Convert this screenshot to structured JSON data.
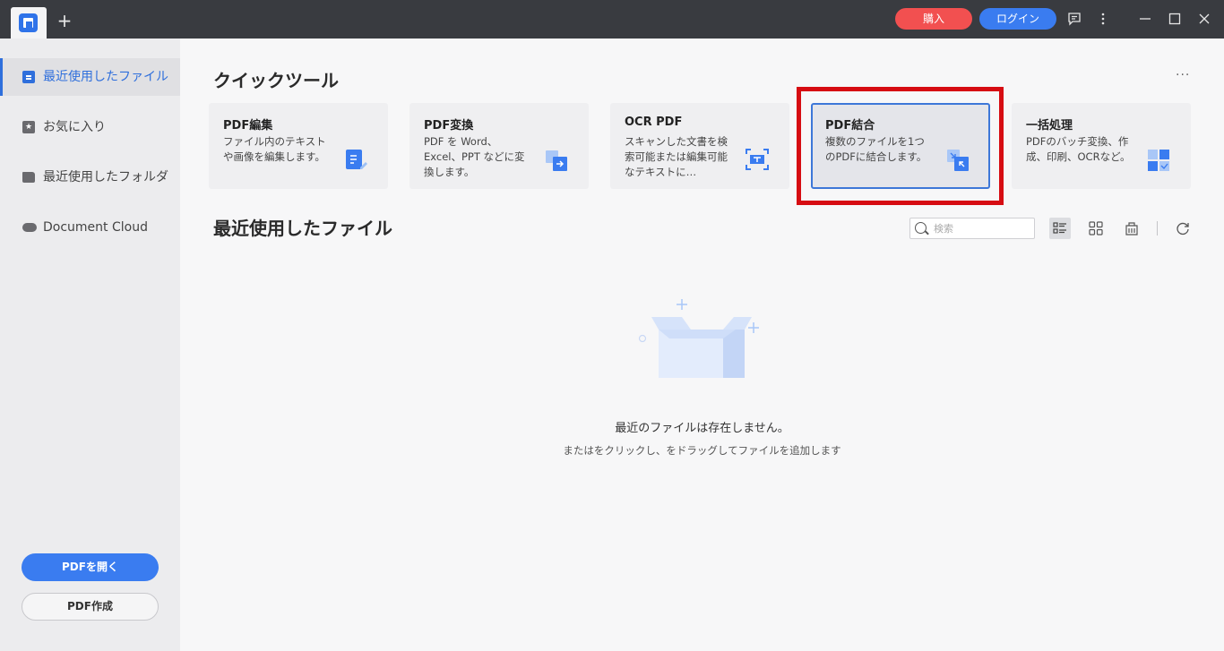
{
  "titlebar": {
    "buy_label": "購入",
    "login_label": "ログイン",
    "new_tab_symbol": "+"
  },
  "sidebar": {
    "items": [
      {
        "label": "最近使用したファイル",
        "icon": "recent-file-icon",
        "active": true
      },
      {
        "label": "お気に入り",
        "icon": "star-icon",
        "active": false
      },
      {
        "label": "最近使用したフォルダ",
        "icon": "folder-icon",
        "active": false
      },
      {
        "label": "Document Cloud",
        "icon": "cloud-icon",
        "active": false
      }
    ],
    "open_pdf_label": "PDFを開く",
    "create_pdf_label": "PDF作成"
  },
  "quick_tools": {
    "title": "クイックツール",
    "more_symbol": "···",
    "cards": [
      {
        "title": "PDF編集",
        "desc": "ファイル内のテキストや画像を編集します。",
        "icon": "edit-pdf-icon"
      },
      {
        "title": "PDF変換",
        "desc": "PDF を Word、Excel、PPT などに変換します。",
        "icon": "convert-pdf-icon"
      },
      {
        "title": "OCR PDF",
        "desc": "スキャンした文書を検索可能または編集可能なテキストに…",
        "icon": "ocr-icon"
      },
      {
        "title": "PDF結合",
        "desc": "複数のファイルを1つのPDFに結合します。",
        "icon": "combine-pdf-icon",
        "selected": true
      },
      {
        "title": "一括処理",
        "desc": "PDFのバッチ変換、作成、印刷、OCRなど。",
        "icon": "batch-process-icon"
      }
    ]
  },
  "recent": {
    "title": "最近使用したファイル",
    "search_placeholder": "検索",
    "empty_title": "最近のファイルは存在しません。",
    "empty_subtitle": "またはをクリックし、をドラッグしてファイルを追加します"
  },
  "colors": {
    "accent": "#3a7cf0",
    "buy": "#f25050",
    "titlebar": "#393b40",
    "highlight": "#d60c12"
  }
}
